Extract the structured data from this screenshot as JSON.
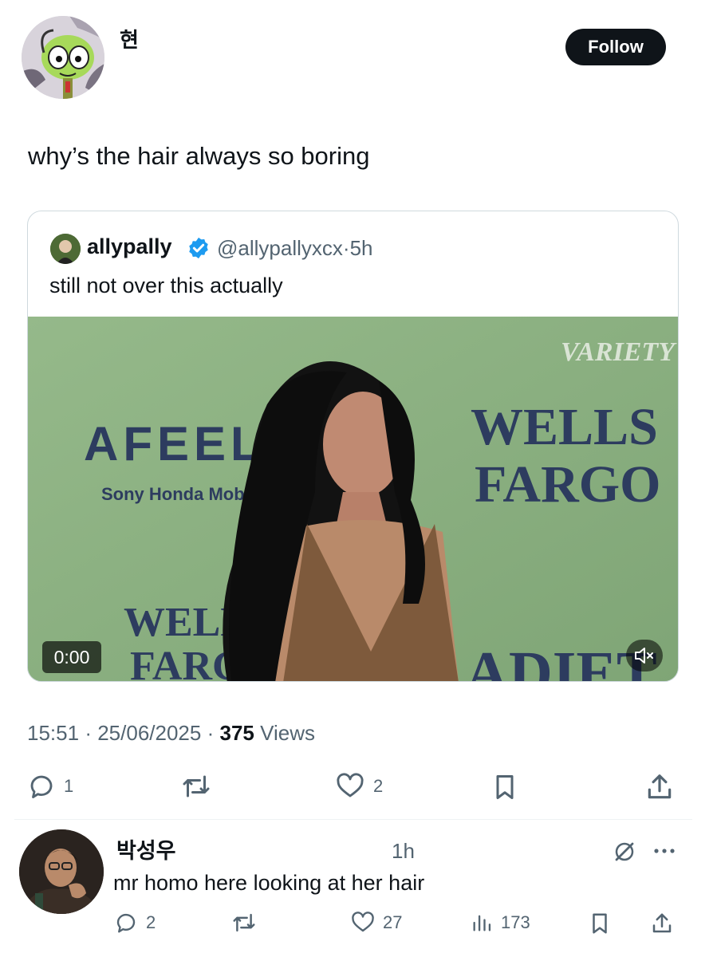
{
  "author": {
    "display_name": "현",
    "follow_label": "Follow"
  },
  "tweet": {
    "text": "why’s the hair always so boring",
    "time": "15:51",
    "date": "25/06/2025",
    "views_count": "375",
    "views_label": "Views",
    "sep": "·"
  },
  "quote": {
    "name": "allypally",
    "handle": "@allypallyxcx",
    "sep": "·",
    "age": "5h",
    "text": "still not over this actually",
    "video_time": "0:00",
    "media_signage": {
      "brand_left": "AFEEL",
      "brand_left_sub": "Sony Honda Mobil",
      "brand_right_1": "WELLS",
      "brand_right_2": "FARGO",
      "brand_corner": "VARIETY",
      "brand_bottom_1": "WELL",
      "brand_bottom_2": "FARG",
      "brand_bottom_right": "ADIET"
    }
  },
  "actions": {
    "replies": "1",
    "likes": "2"
  },
  "reply": {
    "name": "박성우",
    "age": "1h",
    "text": "mr homo here looking at her hair",
    "replies": "2",
    "likes": "27",
    "views": "173"
  },
  "colors": {
    "verified": "#1d9bf0",
    "muted_text": "#536471",
    "backdrop_green": "#8db182",
    "brand_navy": "#2d3c5f"
  }
}
